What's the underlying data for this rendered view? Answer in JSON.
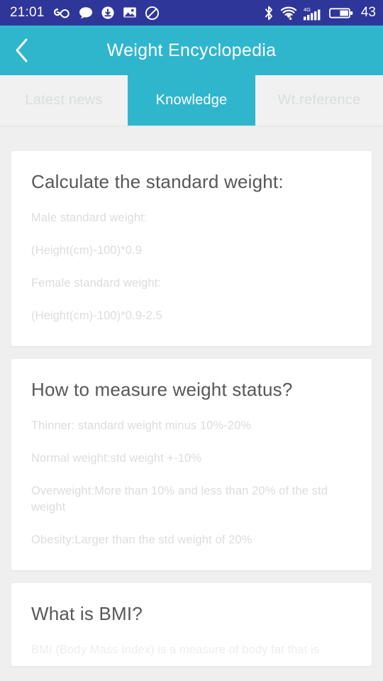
{
  "status_bar": {
    "time": "21:01",
    "battery_level": "43",
    "left_icons": [
      "infinity-icon",
      "chat-bubble-icon",
      "download-sync-icon",
      "image-icon",
      "do-not-disturb-icon"
    ],
    "right_icons": [
      "bluetooth-icon",
      "wifi-icon",
      "signal-4g-icon",
      "battery-icon"
    ],
    "network_label": "4G",
    "background_color": "#2f3699"
  },
  "app_bar": {
    "back_icon": "chevron-left-icon",
    "title": "Weight Encyclopedia",
    "background_color": "#2fb6cd"
  },
  "tabs": {
    "active_index": 1,
    "items": [
      {
        "label": "Latest news"
      },
      {
        "label": "Knowledge"
      },
      {
        "label": "Wt.reference"
      }
    ]
  },
  "cards": [
    {
      "title": "Calculate the standard weight:",
      "lines": [
        "Male standard weight:",
        "(Height(cm)-100)*0.9",
        "Female standard weight:",
        "(Height(cm)-100)*0.9-2.5"
      ]
    },
    {
      "title": "How to measure weight status?",
      "lines": [
        "Thinner: standard weight minus 10%-20%",
        "Normal weight:std weight +-10%",
        "Overweight:More than 10% and less than 20% of the std weight",
        "Obesity:Larger than the std weight of 20%"
      ]
    },
    {
      "title": "What is BMI?",
      "lines": [
        "BMI (Body Mass Index) is a measure of body fat that is"
      ]
    }
  ]
}
